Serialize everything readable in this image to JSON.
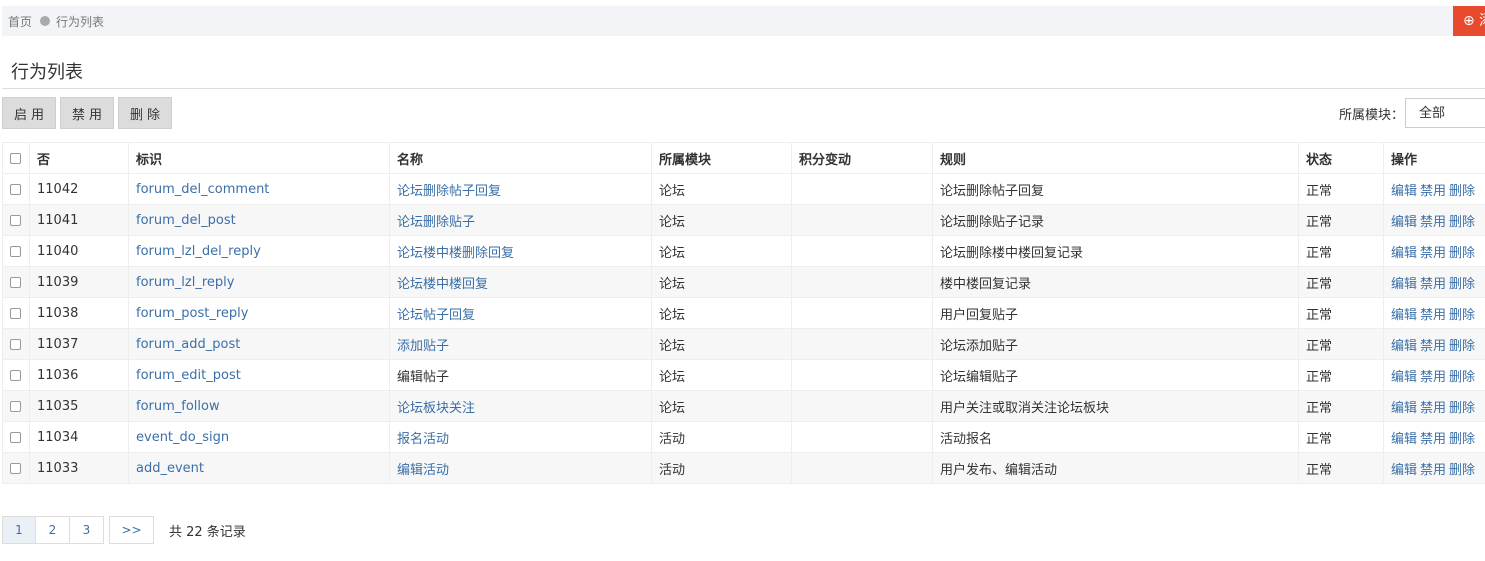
{
  "breadcrumb": {
    "home": "首页",
    "current": "行为列表"
  },
  "header": {
    "add_icon": "plus-circle-icon",
    "add_label": "⊕ 添"
  },
  "page": {
    "title": "行为列表"
  },
  "toolbar": {
    "enable_label": "启用",
    "disable_label": "禁用",
    "delete_label": "删除",
    "filter_label": "所属模块：",
    "filter_value": "全部"
  },
  "table": {
    "headers": [
      "否",
      "标识",
      "名称",
      "所属模块",
      "积分变动",
      "规则",
      "状态",
      "操作"
    ],
    "rows": [
      {
        "id": "11042",
        "key": "forum_del_comment",
        "name": "论坛删除帖子回复",
        "name_link": true,
        "module": "论坛",
        "points": "",
        "rule": "论坛删除帖子回复",
        "status": "正常"
      },
      {
        "id": "11041",
        "key": "forum_del_post",
        "name": "论坛删除贴子",
        "name_link": true,
        "module": "论坛",
        "points": "",
        "rule": "论坛删除贴子记录",
        "status": "正常"
      },
      {
        "id": "11040",
        "key": "forum_lzl_del_reply",
        "name": "论坛楼中楼删除回复",
        "name_link": true,
        "module": "论坛",
        "points": "",
        "rule": "论坛删除楼中楼回复记录",
        "status": "正常"
      },
      {
        "id": "11039",
        "key": "forum_lzl_reply",
        "name": "论坛楼中楼回复",
        "name_link": true,
        "module": "论坛",
        "points": "",
        "rule": "楼中楼回复记录",
        "status": "正常"
      },
      {
        "id": "11038",
        "key": "forum_post_reply",
        "name": "论坛帖子回复",
        "name_link": true,
        "module": "论坛",
        "points": "",
        "rule": "用户回复贴子",
        "status": "正常"
      },
      {
        "id": "11037",
        "key": "forum_add_post",
        "name": "添加贴子",
        "name_link": true,
        "module": "论坛",
        "points": "",
        "rule": "论坛添加贴子",
        "status": "正常"
      },
      {
        "id": "11036",
        "key": "forum_edit_post",
        "name": "编辑帖子",
        "name_link": false,
        "module": "论坛",
        "points": "",
        "rule": "论坛编辑贴子",
        "status": "正常"
      },
      {
        "id": "11035",
        "key": "forum_follow",
        "name": "论坛板块关注",
        "name_link": true,
        "module": "论坛",
        "points": "",
        "rule": "用户关注或取消关注论坛板块",
        "status": "正常"
      },
      {
        "id": "11034",
        "key": "event_do_sign",
        "name": "报名活动",
        "name_link": true,
        "module": "活动",
        "points": "",
        "rule": "活动报名",
        "status": "正常"
      },
      {
        "id": "11033",
        "key": "add_event",
        "name": "编辑活动",
        "name_link": true,
        "module": "活动",
        "points": "",
        "rule": "用户发布、编辑活动",
        "status": "正常"
      }
    ],
    "actions": {
      "edit": "编辑",
      "disable": "禁用",
      "delete": "删除"
    }
  },
  "pagination": {
    "pages": [
      "1",
      "2",
      "3"
    ],
    "current": "1",
    "next": ">>",
    "total_text": "共 22 条记录"
  },
  "colors": {
    "link": "#3a6fa8",
    "accent": "#e84a2e",
    "topbar": "#f3f4f7"
  }
}
